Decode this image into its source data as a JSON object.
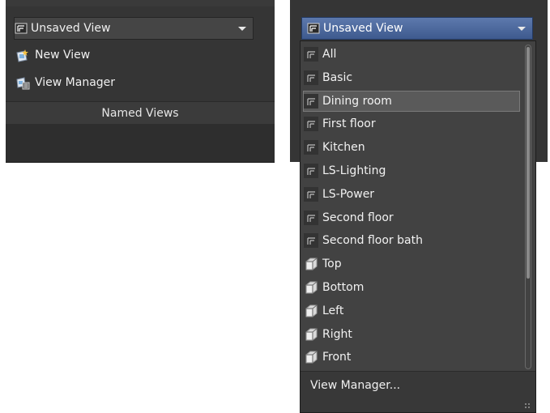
{
  "left_panel": {
    "dropdown_value": "Unsaved View",
    "new_view_label": "New View",
    "view_manager_label": "View Manager",
    "panel_title": "Named Views"
  },
  "right_panel": {
    "dropdown_value": "Unsaved View",
    "named_views": [
      "All",
      "Basic",
      "Dining room",
      "First floor",
      "Kitchen",
      "LS-Lighting",
      "LS-Power",
      "Second floor",
      "Second floor bath"
    ],
    "highlighted": "Dining room",
    "preset_views": [
      "Top",
      "Bottom",
      "Left",
      "Right",
      "Front"
    ],
    "footer_label": "View Manager..."
  },
  "colors": {
    "panel_bg": "#353535",
    "list_bg": "#424242",
    "selected_gradient_top": "#5d79ad",
    "selected_gradient_bottom": "#3e5a8e",
    "highlight_bg": "#5a5a5a"
  },
  "icons": {
    "named_view": "named-view-icon",
    "new_view": "new-view-icon",
    "view_manager": "view-manager-icon",
    "preset_cube": "cube-view-icon"
  }
}
